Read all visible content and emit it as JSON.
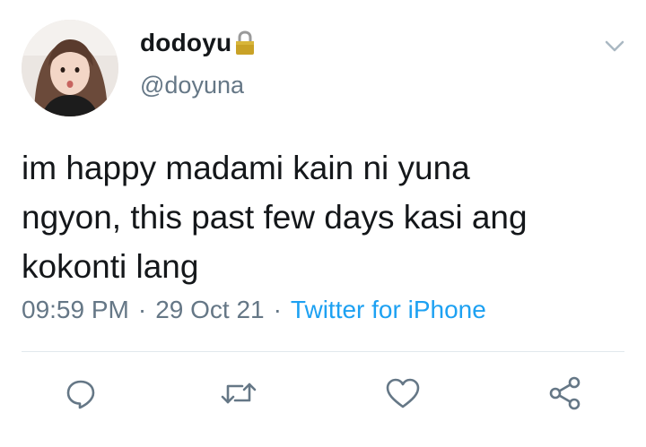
{
  "tweet": {
    "display_name": "dodoyu",
    "handle": "@doyuna",
    "text": "im happy madami kain ni yuna\nngyon, this past few days kasi ang\nkokonti lang",
    "time": "09:59 PM",
    "date": "29 Oct 21",
    "separator": "·",
    "source": "Twitter for iPhone"
  },
  "icons": {
    "lock": "lock-icon",
    "menu": "chevron-down-icon",
    "reply": "reply-icon",
    "retweet": "retweet-icon",
    "like": "heart-icon",
    "share": "share-icon"
  },
  "colors": {
    "text": "#14171a",
    "secondary": "#657786",
    "link": "#1da1f2",
    "divider": "#e1e8ed",
    "lock": "#c9a227"
  }
}
